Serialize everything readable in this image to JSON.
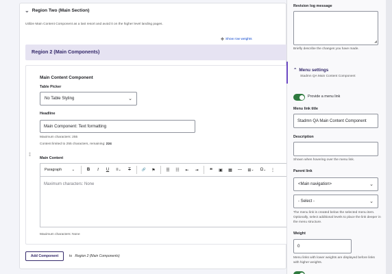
{
  "region": {
    "title": "Region Two (Main Section)",
    "description": "Utilize Main Content Component as a last resort and avoid it on the higher level landing pages.",
    "show_weights": "Show row weights",
    "components_title": "Region 2 (Main Components)"
  },
  "component": {
    "title": "Main Content Component",
    "table_picker_label": "Table Picker",
    "table_picker_value": "No Table Styling",
    "headline_label": "Headline",
    "headline_value": "Main Component: Text formatting",
    "max_chars": "Maximum characters: 255",
    "limit_text": "Content limited to 255 characters, remaining:",
    "remaining": "224",
    "main_content_label": "Main Content",
    "editor_placeholder": "Maximum characters: None",
    "max_chars_none": "Maximum characters: None"
  },
  "toolbar": {
    "paragraph": "Paragraph",
    "bold": "B",
    "italic": "I",
    "underline": "U",
    "align": "≡",
    "clear": "T",
    "link": "🔗",
    "flag": "⚑",
    "bullets": "☰",
    "numbers": "☷",
    "outdent": "⇤",
    "indent": "⇥",
    "quote": "❝",
    "image": "▣",
    "media": "▦",
    "hr": "—",
    "table": "⊞",
    "special": "Ω",
    "more": "⋮"
  },
  "add_component": {
    "button": "Add Component",
    "to_prefix": "to",
    "to_target": "Region 2 (Main Components)"
  },
  "sidebar": {
    "revision_label": "Revision log message",
    "revision_hint": "Briefly describe the changes you have made.",
    "menu_settings": "Menu settings",
    "menu_settings_sub": "Stadmn QA Main Content Component",
    "provide_menu_link": "Provide a menu link",
    "menu_link_title_label": "Menu link title",
    "menu_link_title_value": "Stadmn QA Main Content Component",
    "description_label": "Description",
    "description_hint": "Shown when hovering over the menu link.",
    "parent_link_label": "Parent link",
    "parent_link_value": "<Main navigation>",
    "parent_select_value": "- Select -",
    "parent_hint": "The menu link is created below the selected menu item. Optionally, select additional levels to place the link deeper in the menu structure.",
    "weight_label": "Weight",
    "weight_value": "0",
    "weight_hint": "Menu links with lower weights are displayed before links with higher weights."
  },
  "colors": {
    "accent": "#34296a",
    "toggle_on": "#2f7a3f",
    "link": "#003ecc"
  }
}
